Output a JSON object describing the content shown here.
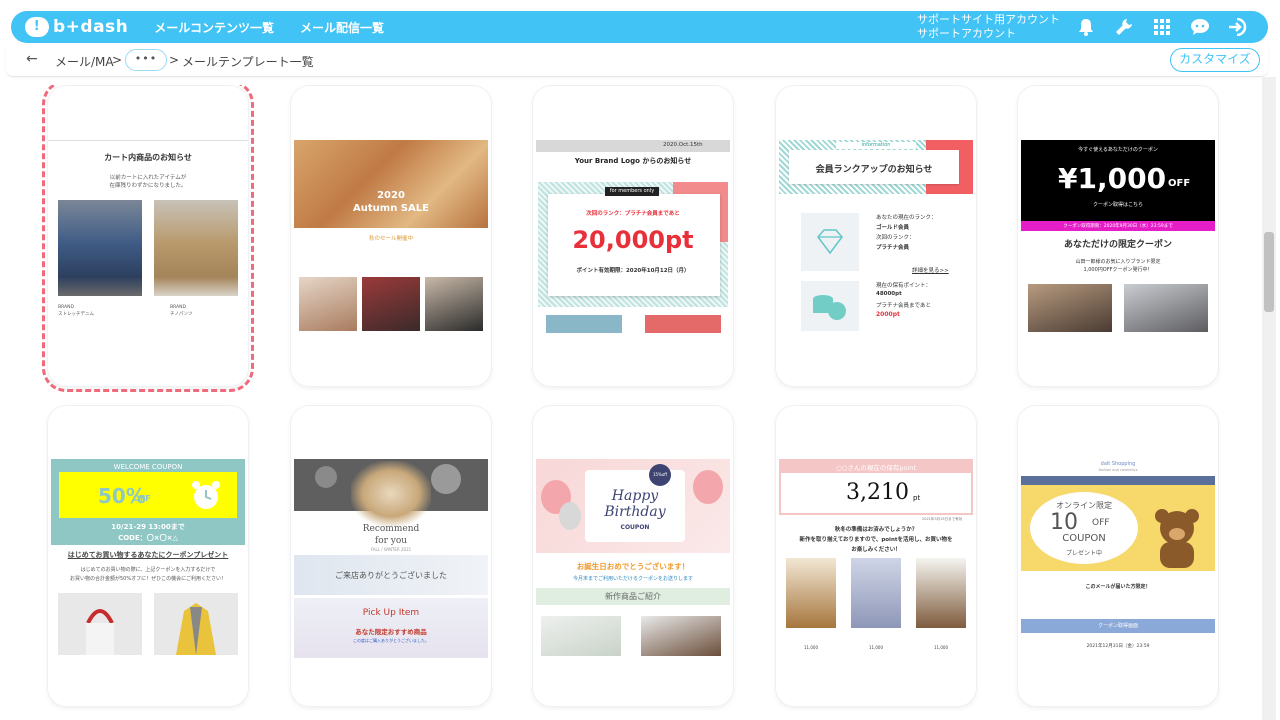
{
  "header": {
    "logo": "b+dash",
    "nav": [
      "メールコンテンツ一覧",
      "メール配信一覧"
    ],
    "account_line1": "サポートサイト用アカウント",
    "account_line2": "サポートアカウント",
    "icons": [
      "bell-icon",
      "wrench-icon",
      "grid-icon",
      "chat-icon",
      "logout-icon"
    ]
  },
  "breadcrumb": {
    "back": "←",
    "item1": "メール/MA",
    "sep": ">",
    "dots": "•••",
    "item2": "メールテンプレート一覧",
    "customize": "カスタマイズ"
  },
  "cards": {
    "c1": {
      "title": "カート内商品のお知らせ",
      "desc1": "以前カートに入れたアイテムが",
      "desc2": "在庫残りわずかになりました。",
      "p1": "BRAND",
      "p1b": "ストレッチデニム",
      "p2": "BRAND",
      "p2b": "チノパンツ"
    },
    "c2": {
      "year": "2020",
      "sale": "Autumn SALE",
      "sub": "秋のセール開催中"
    },
    "c3": {
      "date": "2020.Oct.15th",
      "logo": "Your Brand Logo からのお知らせ",
      "members": "for members only",
      "rank": "次回のランク：プラチナ会員まであと",
      "pt": "20,000pt",
      "expire": "ポイント有効期限：2020年10月12日（月）"
    },
    "c4": {
      "info": "information",
      "title": "会員ランクアップのお知らせ",
      "l1": "あなたの現在のランク：",
      "l2": "ゴールド会員",
      "l3": "次回のランク：",
      "l4": "プラチナ会員",
      "more": "詳細を見る>>",
      "l5": "現在の保有ポイント：",
      "l6": "48000pt",
      "l7": "プラチナ会員まであと",
      "l8": "2000pt"
    },
    "c5": {
      "top": "今すぐ使えるあなただけのクーポン",
      "amount": "¥1,000",
      "off": "OFF",
      "bar": "クーポン取得はこちら",
      "period": "クーポン取得期限：2020年9月30日（水）23:59まで",
      "title": "あなただけの限定クーポン",
      "d1": "山田一郎様のお気に入りブランド限定",
      "d2": "1,000円OFFクーポン発行中！"
    },
    "c6": {
      "welcome": "WELCOME COUPON",
      "pct": "50%",
      "off": "OFF",
      "date": "10/21-29 13:00まで",
      "code": "CODE：〇×〇×△",
      "title": "はじめてお買い物するあなたにクーポンプレゼント",
      "d1": "はじめてのお買い物の際に、上記クーポンを入力するだけで",
      "d2": "お買い物の合計金額が50%オフに！ぜひこの機会にご利用ください！"
    },
    "c7": {
      "rec1": "Recommend",
      "rec2": "for you",
      "season": "FALL / WINTER 2021",
      "thanks": "ご来店ありがとうございました",
      "pick": "Pick Up Item",
      "pick2": "あなた限定おすすめ商品",
      "d1": "この度はご購入ありがとうございました。"
    },
    "c8": {
      "h1": "Happy",
      "h2": "Birthday",
      "coupon": "COUPON",
      "off": "15%off",
      "msg": "お誕生日おめでとうございます！",
      "sub": "今月末までご利用いただけるクーポンをお送りします",
      "new": "新作商品ご紹介"
    },
    "c9": {
      "head": "○○さんの現在の保有point",
      "num": "3,210",
      "unit": "pt",
      "small": "2021年3月15日まで有効",
      "m1": "秋冬の準備はお済みでしょうか？",
      "m2": "新作を取り揃えておりますので、pointを活用し、お買い物を",
      "m3": "お楽しみください！",
      "price": "11,000"
    },
    "c10": {
      "shop": "dalt Shopping",
      "shopsub": "fashion and cosmetics",
      "online": "オンライン限定",
      "pct": "10",
      "off": "OFF",
      "coupon": "COUPON",
      "present": "プレゼント中",
      "m1": "このメールが届いた方限定！",
      "btn": "クーポン取得画面",
      "date": "2021年12月31日（金）23:59"
    }
  }
}
